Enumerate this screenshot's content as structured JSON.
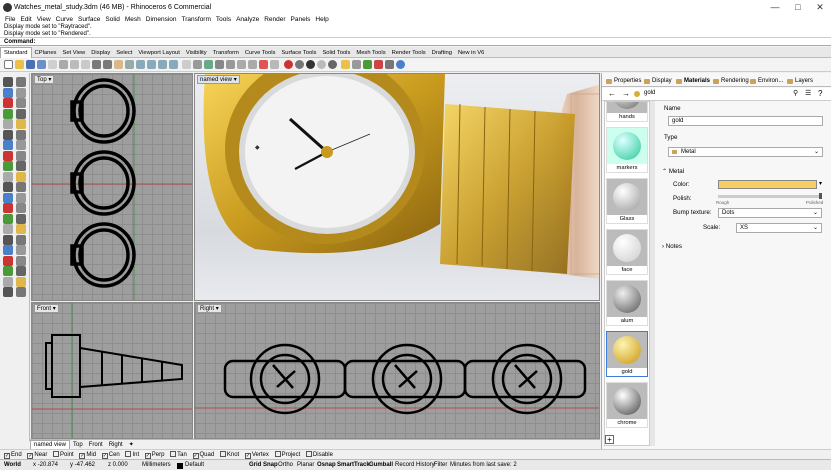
{
  "window": {
    "title": "Watches_metal_study.3dm (46 MB) - Rhinoceros 6 Commercial",
    "minimize": "—",
    "maximize": "□",
    "close": "✕"
  },
  "menu": [
    "File",
    "Edit",
    "View",
    "Curve",
    "Surface",
    "Solid",
    "Mesh",
    "Dimension",
    "Transform",
    "Tools",
    "Analyze",
    "Render",
    "Panels",
    "Help"
  ],
  "history": [
    "Display mode set to \"Raytraced\".",
    "Display mode set to \"Rendered\"."
  ],
  "command_label": "Command:",
  "toolbar_tabs": [
    "Standard",
    "CPlanes",
    "Set View",
    "Display",
    "Select",
    "Viewport Layout",
    "Visibility",
    "Transform",
    "Curve Tools",
    "Surface Tools",
    "Solid Tools",
    "Mesh Tools",
    "Render Tools",
    "Drafting",
    "New in V6"
  ],
  "viewports": {
    "top": "Top",
    "named": "named view",
    "front": "Front",
    "right": "Right",
    "dropdown": "▾"
  },
  "viewport_tabs": [
    "named view",
    "Top",
    "Front",
    "Right"
  ],
  "viewport_tab_add": "✦",
  "osnaps": [
    {
      "label": "End",
      "checked": true
    },
    {
      "label": "Near",
      "checked": true
    },
    {
      "label": "Point",
      "checked": false
    },
    {
      "label": "Mid",
      "checked": true
    },
    {
      "label": "Cen",
      "checked": true
    },
    {
      "label": "Int",
      "checked": false
    },
    {
      "label": "Perp",
      "checked": true
    },
    {
      "label": "Tan",
      "checked": false
    },
    {
      "label": "Quad",
      "checked": true
    },
    {
      "label": "Knot",
      "checked": false
    },
    {
      "label": "Vertex",
      "checked": true
    },
    {
      "label": "Project",
      "checked": false
    },
    {
      "label": "Disable",
      "checked": false
    }
  ],
  "status": {
    "cplane": "World",
    "x": "x -20.874",
    "y": "y -47.462",
    "z": "z 0.000",
    "units": "Millimeters",
    "layer": "Default",
    "buttons": [
      "Grid Snap",
      "Ortho",
      "Planar",
      "Osnap",
      "SmartTrack",
      "Gumball",
      "Record History",
      "Filter"
    ],
    "message": "Minutes from last save: 2"
  },
  "panel": {
    "tabs": [
      "Properties",
      "Display",
      "Materials",
      "Rendering",
      "Environ...",
      "Layers"
    ],
    "search_value": "gold",
    "thumbnails": [
      "hands",
      "markers",
      "Glass",
      "face",
      "alum",
      "gold",
      "chrome"
    ],
    "name_label": "Name",
    "name_value": "gold",
    "type_label": "Type",
    "type_value": "Metal",
    "metal_label": "Metal",
    "color_label": "Color:",
    "color_value": "#f5cf62",
    "polish_label": "Polish:",
    "polish_min": "Rough",
    "polish_max": "Polished",
    "bump_label": "Bump texture:",
    "bump_value": "Dots",
    "scale_label": "Scale:",
    "scale_value": "XS",
    "notes_label": "Notes",
    "add_button": "+"
  }
}
